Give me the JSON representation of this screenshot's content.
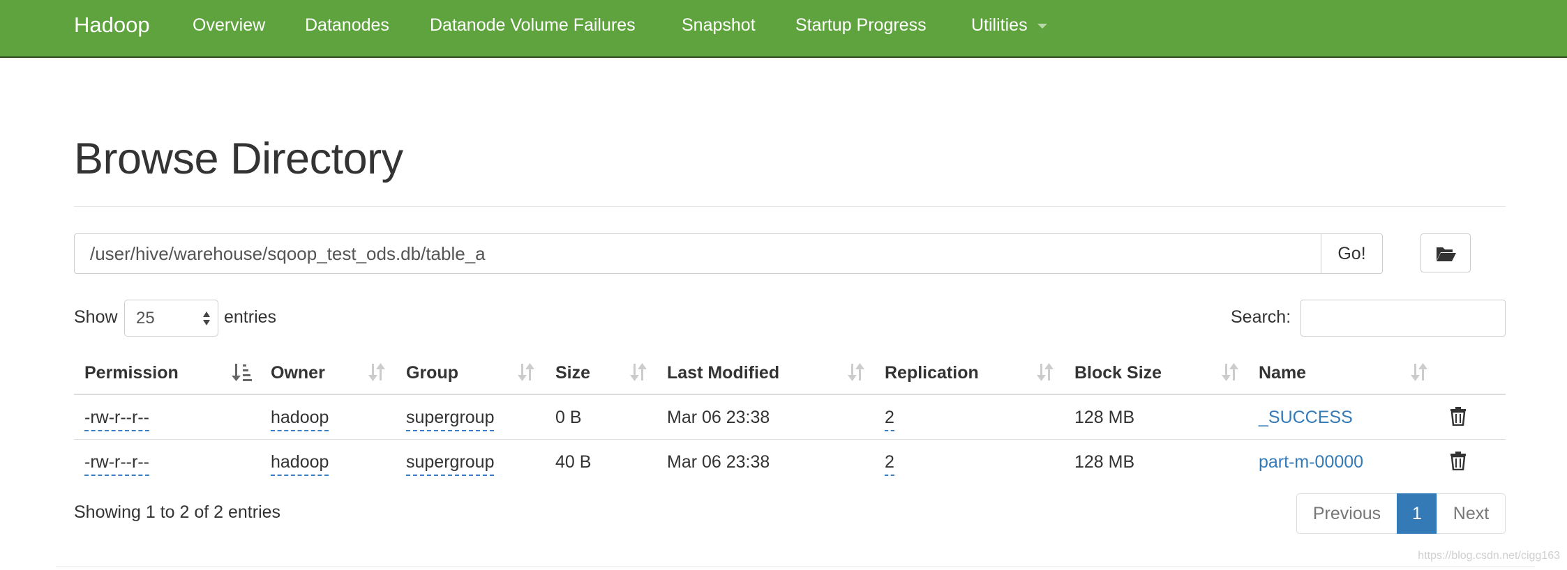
{
  "navbar": {
    "brand": "Hadoop",
    "items": [
      {
        "label": "Overview"
      },
      {
        "label": "Datanodes"
      },
      {
        "label": "Datanode Volume Failures"
      },
      {
        "label": "Snapshot"
      },
      {
        "label": "Startup Progress"
      },
      {
        "label": "Utilities"
      }
    ]
  },
  "page": {
    "title": "Browse Directory"
  },
  "path_bar": {
    "value": "/user/hive/warehouse/sqoop_test_ods.db/table_a",
    "go_label": "Go!",
    "folder_icon": "folder-open-icon"
  },
  "controls": {
    "show_label": "Show",
    "page_length": "25",
    "entries_label": "entries",
    "search_label": "Search:",
    "search_value": ""
  },
  "table": {
    "columns": [
      {
        "label": "Permission",
        "sort": "ascending"
      },
      {
        "label": "Owner",
        "sort": "none"
      },
      {
        "label": "Group",
        "sort": "none"
      },
      {
        "label": "Size",
        "sort": "none"
      },
      {
        "label": "Last Modified",
        "sort": "none"
      },
      {
        "label": "Replication",
        "sort": "none"
      },
      {
        "label": "Block Size",
        "sort": "none"
      },
      {
        "label": "Name",
        "sort": "none"
      }
    ],
    "rows": [
      {
        "permission": "-rw-r--r--",
        "owner": "hadoop",
        "group": "supergroup",
        "size": "0 B",
        "last_modified": "Mar 06 23:38",
        "replication": "2",
        "block_size": "128 MB",
        "name": "_SUCCESS"
      },
      {
        "permission": "-rw-r--r--",
        "owner": "hadoop",
        "group": "supergroup",
        "size": "40 B",
        "last_modified": "Mar 06 23:38",
        "replication": "2",
        "block_size": "128 MB",
        "name": "part-m-00000"
      }
    ]
  },
  "footer": {
    "info": "Showing 1 to 2 of 2 entries",
    "pagination": {
      "previous": "Previous",
      "current": "1",
      "next": "Next"
    },
    "watermark": "https://blog.csdn.net/cigg163"
  },
  "colors": {
    "navbar_bg": "#5fa33e",
    "link": "#337ab7",
    "active_page": "#337ab7"
  }
}
